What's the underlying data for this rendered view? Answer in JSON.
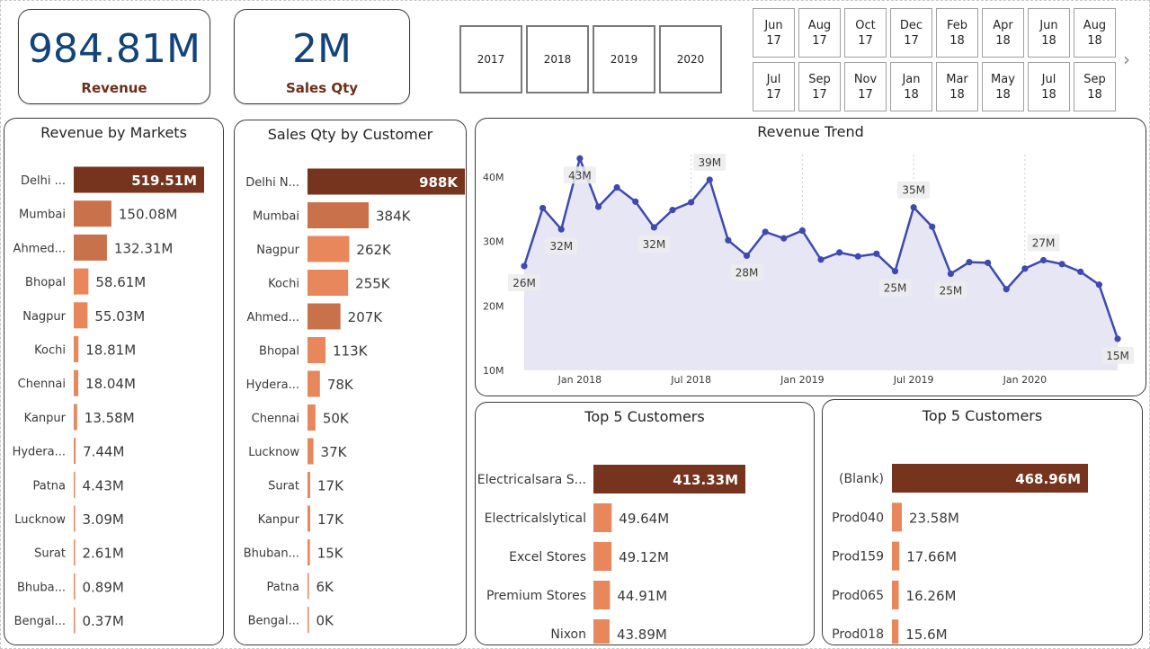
{
  "kpis": {
    "revenue": {
      "value": "984.81M",
      "label": "Revenue"
    },
    "sales_qty": {
      "value": "2M",
      "label": "Sales Qty"
    }
  },
  "year_slicer": [
    "2017",
    "2018",
    "2019",
    "2020"
  ],
  "month_slicer": [
    [
      "Jun",
      "17"
    ],
    [
      "Aug",
      "17"
    ],
    [
      "Oct",
      "17"
    ],
    [
      "Dec",
      "17"
    ],
    [
      "Feb",
      "18"
    ],
    [
      "Apr",
      "18"
    ],
    [
      "Jun",
      "18"
    ],
    [
      "Aug",
      "18"
    ],
    [
      "Jul",
      "17"
    ],
    [
      "Sep",
      "17"
    ],
    [
      "Nov",
      "17"
    ],
    [
      "Jan",
      "18"
    ],
    [
      "Mar",
      "18"
    ],
    [
      "May",
      "18"
    ],
    [
      "Jul",
      "18"
    ],
    [
      "Sep",
      "18"
    ]
  ],
  "colors": {
    "dark": "#76341e",
    "mid": "#c9714b",
    "light": "#e8865c",
    "line": "#3f49b0",
    "area": "#e6e6f4",
    "kpi_value": "#12437a"
  },
  "chart_data": [
    {
      "id": "markets",
      "type": "bar",
      "title": "Revenue by Markets",
      "categories": [
        "Delhi ...",
        "Mumbai",
        "Ahmed...",
        "Bhopal",
        "Nagpur",
        "Kochi",
        "Chennai",
        "Kanpur",
        "Hydera...",
        "Patna",
        "Lucknow",
        "Surat",
        "Bhuba...",
        "Bengal..."
      ],
      "values": [
        519.51,
        150.08,
        132.31,
        58.61,
        55.03,
        18.81,
        18.04,
        13.58,
        7.44,
        4.43,
        3.09,
        2.61,
        0.89,
        0.37
      ],
      "labels": [
        "519.51M",
        "150.08M",
        "132.31M",
        "58.61M",
        "55.03M",
        "18.81M",
        "18.04M",
        "13.58M",
        "7.44M",
        "4.43M",
        "3.09M",
        "2.61M",
        "0.89M",
        "0.37M"
      ],
      "shades": [
        "dark",
        "mid",
        "mid",
        "light",
        "light",
        "light",
        "light",
        "light",
        "light",
        "light",
        "light",
        "light",
        "light",
        "light"
      ]
    },
    {
      "id": "customers_qty",
      "type": "bar",
      "title": "Sales Qty by Customer",
      "categories": [
        "Delhi N...",
        "Mumbai",
        "Nagpur",
        "Kochi",
        "Ahmed...",
        "Bhopal",
        "Hydera...",
        "Chennai",
        "Lucknow",
        "Surat",
        "Kanpur",
        "Bhuban...",
        "Patna",
        "Bengal..."
      ],
      "values": [
        988,
        384,
        262,
        255,
        207,
        113,
        78,
        50,
        37,
        17,
        17,
        15,
        6,
        0
      ],
      "labels": [
        "988K",
        "384K",
        "262K",
        "255K",
        "207K",
        "113K",
        "78K",
        "50K",
        "37K",
        "17K",
        "17K",
        "15K",
        "6K",
        "0K"
      ],
      "shades": [
        "dark",
        "mid",
        "light",
        "light",
        "mid",
        "light",
        "light",
        "light",
        "light",
        "light",
        "light",
        "light",
        "light",
        "light"
      ]
    },
    {
      "id": "trend",
      "type": "area",
      "title": "Revenue Trend",
      "x_ticks": [
        "Jan 2018",
        "Jul 2018",
        "Jan 2019",
        "Jul 2019",
        "Jan 2020"
      ],
      "y_ticks": [
        "10M",
        "20M",
        "30M",
        "40M"
      ],
      "ylim": [
        10,
        40
      ],
      "x_start": "Oct 2017",
      "values": [
        26.2,
        35.2,
        31.9,
        42.9,
        35.4,
        38.4,
        36.2,
        32.2,
        34.9,
        36.1,
        39.6,
        30.2,
        27.8,
        31.5,
        30.5,
        31.7,
        27.2,
        28.3,
        27.7,
        28.1,
        25.4,
        35.3,
        32.3,
        25.0,
        26.8,
        26.7,
        22.6,
        25.8,
        27.1,
        26.5,
        25.3,
        23.3,
        14.9
      ],
      "point_labels": [
        {
          "index": 0,
          "text": "26M",
          "pos": "below"
        },
        {
          "index": 2,
          "text": "32M",
          "pos": "below"
        },
        {
          "index": 3,
          "text": "43M",
          "pos": "below"
        },
        {
          "index": 7,
          "text": "32M",
          "pos": "below"
        },
        {
          "index": 10,
          "text": "39M",
          "pos": "above"
        },
        {
          "index": 12,
          "text": "28M",
          "pos": "below"
        },
        {
          "index": 20,
          "text": "25M",
          "pos": "below"
        },
        {
          "index": 21,
          "text": "35M",
          "pos": "above"
        },
        {
          "index": 23,
          "text": "25M",
          "pos": "below"
        },
        {
          "index": 28,
          "text": "27M",
          "pos": "above"
        },
        {
          "index": 32,
          "text": "15M",
          "pos": "below"
        }
      ]
    },
    {
      "id": "top5_customers",
      "type": "bar",
      "title": "Top 5 Customers",
      "categories": [
        "Electricalsara S...",
        "Electricalslytical",
        "Excel Stores",
        "Premium Stores",
        "Nixon"
      ],
      "values": [
        413.33,
        49.64,
        49.12,
        44.91,
        43.89
      ],
      "labels": [
        "413.33M",
        "49.64M",
        "49.12M",
        "44.91M",
        "43.89M"
      ],
      "shades": [
        "dark",
        "light",
        "light",
        "light",
        "light"
      ]
    },
    {
      "id": "top5_products",
      "type": "bar",
      "title": "Top 5 Customers",
      "categories": [
        "(Blank)",
        "Prod040",
        "Prod159",
        "Prod065",
        "Prod018"
      ],
      "values": [
        468.96,
        23.58,
        17.66,
        16.26,
        15.6
      ],
      "labels": [
        "468.96M",
        "23.58M",
        "17.66M",
        "16.26M",
        "15.6M"
      ],
      "shades": [
        "dark",
        "light",
        "light",
        "light",
        "light"
      ]
    }
  ]
}
